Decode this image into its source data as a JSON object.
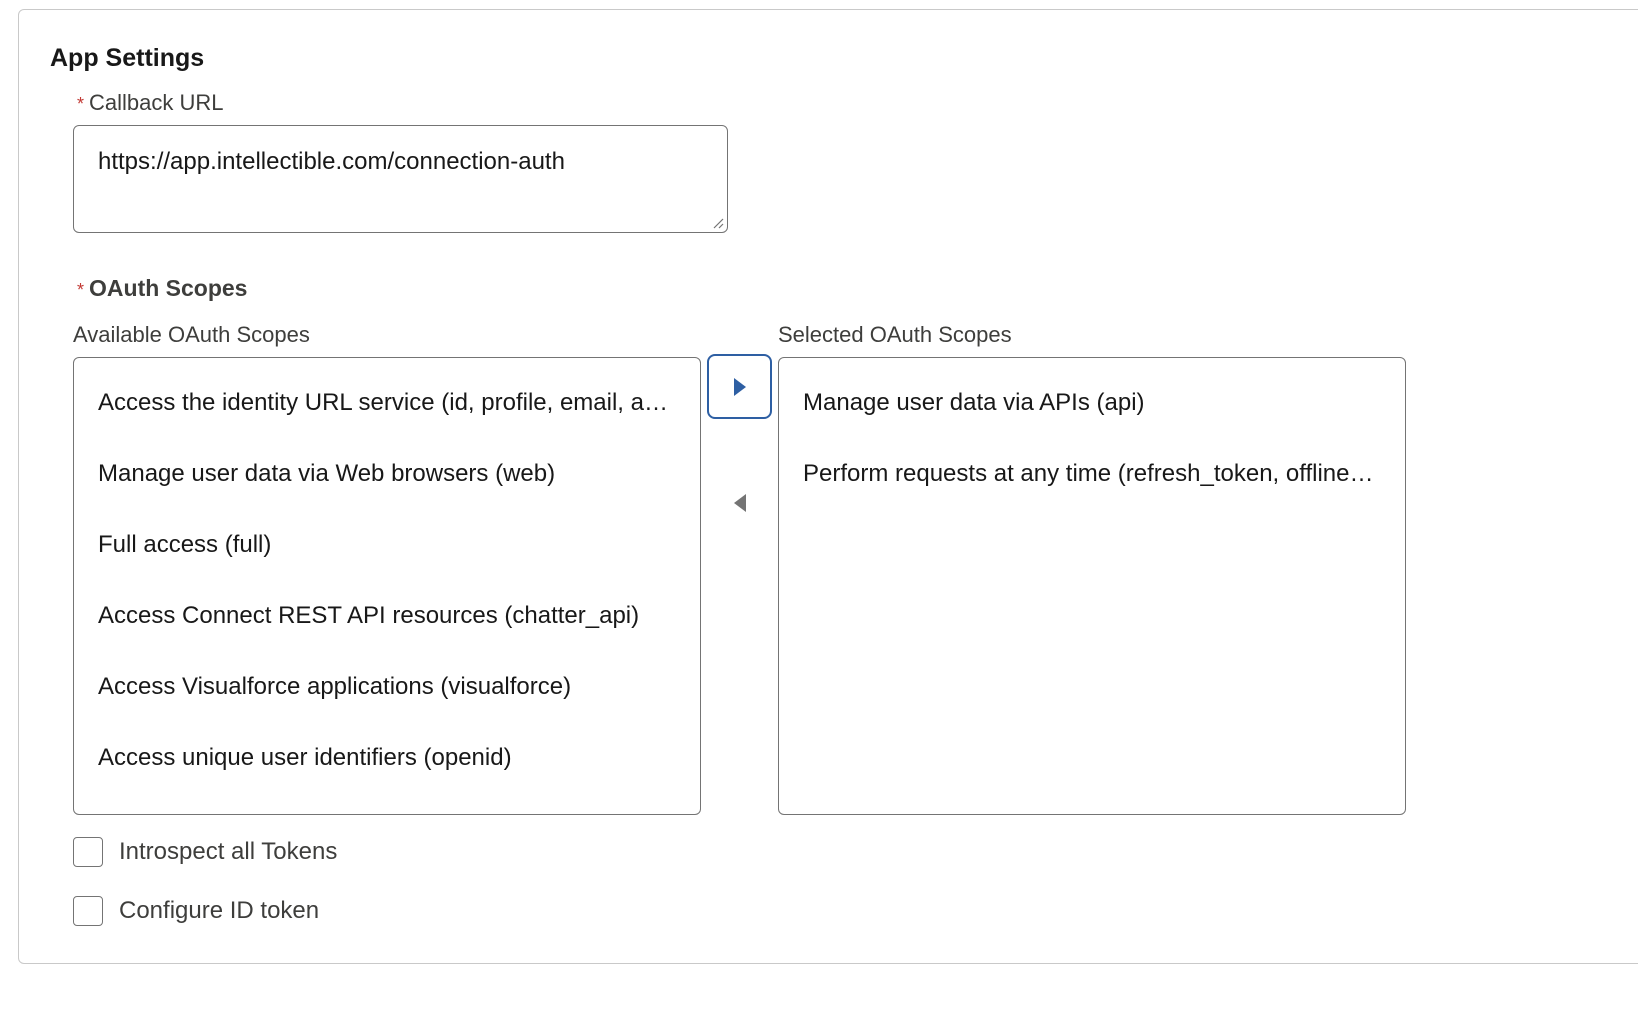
{
  "section": {
    "title": "App Settings"
  },
  "callback": {
    "required_marker": "*",
    "label": "Callback URL",
    "value": "https://app.intellectible.com/connection-auth"
  },
  "oauth": {
    "required_marker": "*",
    "label": "OAuth Scopes",
    "available_label": "Available OAuth Scopes",
    "selected_label": "Selected OAuth Scopes",
    "available": [
      "Access the identity URL service (id, profile, email, address, phone)",
      "Manage user data via Web browsers (web)",
      "Full access (full)",
      "Access Connect REST API resources (chatter_api)",
      "Access Visualforce applications (visualforce)",
      "Access unique user identifiers (openid)"
    ],
    "selected": [
      "Manage user data via APIs (api)",
      "Perform requests at any time (refresh_token, offline_access)"
    ],
    "accent_color": "#2e5fa3"
  },
  "options": {
    "introspect_label": "Introspect all Tokens",
    "introspect_checked": false,
    "id_token_label": "Configure ID token",
    "id_token_checked": false
  }
}
